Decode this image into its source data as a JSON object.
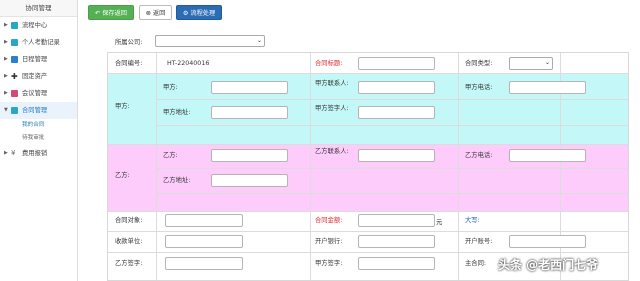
{
  "sidebar": {
    "title": "协同管理",
    "items": [
      {
        "label": "流程中心",
        "color": "#2aa6c7"
      },
      {
        "label": "个人考勤记录",
        "color": "#2aa6c7"
      },
      {
        "label": "日程管理",
        "color": "#2a7fd1"
      },
      {
        "label": "固定资产",
        "color": "#333333"
      },
      {
        "label": "会议管理",
        "color": "#d04a7c"
      },
      {
        "label": "合同管理",
        "color": "#2aa6c7"
      },
      {
        "label": "费用报销",
        "color": "#666666"
      }
    ],
    "subitems": [
      "我的合同",
      "待我审批"
    ]
  },
  "toolbar": {
    "save_label": "保存返回",
    "back_label": "返回",
    "process_label": "流程处理"
  },
  "company": {
    "label": "所属公司:"
  },
  "form": {
    "contract_no_label": "合同编号:",
    "contract_no_value": "HT-22040016",
    "contract_title_label": "合同标题:",
    "contract_type_label": "合同类型:",
    "party_a_section": "甲方:",
    "party_a_label": "甲方:",
    "party_a_contact_label": "甲方联系人:",
    "party_a_phone_label": "甲方电话:",
    "party_a_address_label": "甲方地址:",
    "party_a_sign_label": "甲方签字人:",
    "party_b_section": "乙方:",
    "party_b_label": "乙方:",
    "party_b_contact_label": "乙方联系人:",
    "party_b_phone_label": "乙方电话:",
    "party_b_address_label": "乙方地址:",
    "object_label": "合同对象:",
    "amount_label": "合同金额:",
    "amount_unit": "元",
    "uppercase_label": "大写:",
    "payee_label": "收款单位:",
    "bank_label": "开户银行:",
    "account_label": "开户账号:",
    "b_sign_label": "乙方签字:",
    "a_sign_label": "甲方签字:",
    "host_label": "主合同:"
  },
  "colors": {
    "party_a_band": "#c4f7f7",
    "party_b_band": "#fdccfb",
    "required_label": "#e0292c",
    "uppercase_label": "#1a57c2",
    "save_button": "#55b055",
    "process_button": "#2b6cb5"
  },
  "watermark": "头条 @老西门七爷"
}
